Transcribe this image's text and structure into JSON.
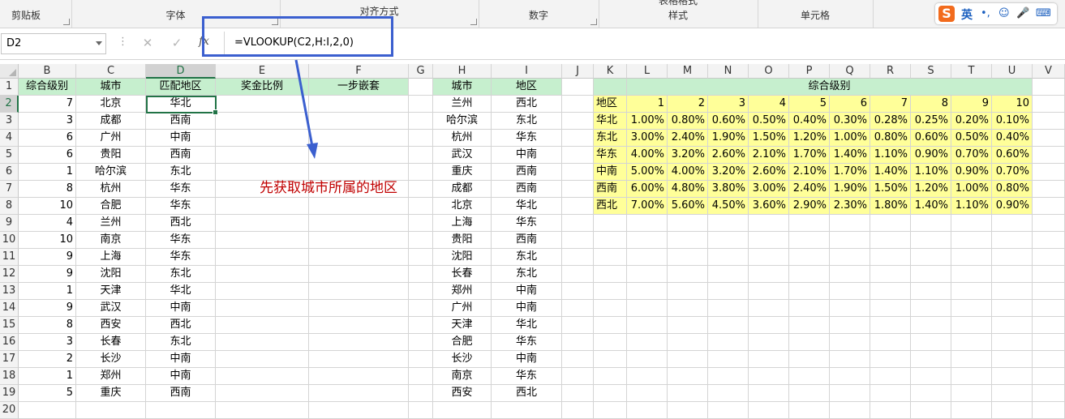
{
  "ribbon": {
    "groups": [
      "剪贴板",
      "字体",
      "对齐方式",
      "数字",
      "样式",
      "单元格"
    ],
    "styles_top": "表格格式",
    "ime": {
      "logo": "S",
      "mode": "英",
      "glyphs": [
        "•,",
        "☺",
        "🎤",
        "⌨"
      ]
    }
  },
  "formula_bar": {
    "name_box": "D2",
    "cancel_icon": "✕",
    "enter_icon": "✓",
    "fx_label": "fx",
    "formula": "=VLOOKUP(C2,H:I,2,0)"
  },
  "columns": [
    "B",
    "C",
    "D",
    "E",
    "F",
    "G",
    "H",
    "I",
    "J",
    "K",
    "L",
    "M",
    "N",
    "O",
    "P",
    "Q",
    "R",
    "S",
    "T",
    "U",
    "V"
  ],
  "rows": [
    "1",
    "2",
    "3",
    "4",
    "5",
    "6",
    "7",
    "8",
    "9",
    "10",
    "11",
    "12",
    "13",
    "14",
    "15",
    "16",
    "17",
    "18",
    "19",
    "20"
  ],
  "left_table": {
    "headers": [
      "综合级别",
      "城市",
      "匹配地区",
      "奖金比例",
      "一步嵌套"
    ],
    "rows": [
      [
        "7",
        "北京",
        "华北"
      ],
      [
        "3",
        "成都",
        "西南"
      ],
      [
        "6",
        "广州",
        "中南"
      ],
      [
        "6",
        "贵阳",
        "西南"
      ],
      [
        "1",
        "哈尔滨",
        "东北"
      ],
      [
        "8",
        "杭州",
        "华东"
      ],
      [
        "10",
        "合肥",
        "华东"
      ],
      [
        "4",
        "兰州",
        "西北"
      ],
      [
        "10",
        "南京",
        "华东"
      ],
      [
        "9",
        "上海",
        "华东"
      ],
      [
        "9",
        "沈阳",
        "东北"
      ],
      [
        "1",
        "天津",
        "华北"
      ],
      [
        "9",
        "武汉",
        "中南"
      ],
      [
        "8",
        "西安",
        "西北"
      ],
      [
        "3",
        "长春",
        "东北"
      ],
      [
        "2",
        "长沙",
        "中南"
      ],
      [
        "1",
        "郑州",
        "中南"
      ],
      [
        "5",
        "重庆",
        "西南"
      ]
    ]
  },
  "lookup_table": {
    "headers": [
      "城市",
      "地区"
    ],
    "rows": [
      [
        "兰州",
        "西北"
      ],
      [
        "哈尔滨",
        "东北"
      ],
      [
        "杭州",
        "华东"
      ],
      [
        "武汉",
        "中南"
      ],
      [
        "重庆",
        "西南"
      ],
      [
        "成都",
        "西南"
      ],
      [
        "北京",
        "华北"
      ],
      [
        "上海",
        "华东"
      ],
      [
        "贵阳",
        "西南"
      ],
      [
        "沈阳",
        "东北"
      ],
      [
        "长春",
        "东北"
      ],
      [
        "郑州",
        "中南"
      ],
      [
        "广州",
        "中南"
      ],
      [
        "天津",
        "华北"
      ],
      [
        "合肥",
        "华东"
      ],
      [
        "长沙",
        "中南"
      ],
      [
        "南京",
        "华东"
      ],
      [
        "西安",
        "西北"
      ]
    ]
  },
  "rate_table": {
    "title": "综合级别",
    "corner": "地区",
    "levels": [
      "1",
      "2",
      "3",
      "4",
      "5",
      "6",
      "7",
      "8",
      "9",
      "10"
    ],
    "rows": [
      {
        "region": "华北",
        "rates": [
          "1.00%",
          "0.80%",
          "0.60%",
          "0.50%",
          "0.40%",
          "0.30%",
          "0.28%",
          "0.25%",
          "0.20%",
          "0.10%"
        ]
      },
      {
        "region": "东北",
        "rates": [
          "3.00%",
          "2.40%",
          "1.90%",
          "1.50%",
          "1.20%",
          "1.00%",
          "0.80%",
          "0.60%",
          "0.50%",
          "0.40%"
        ]
      },
      {
        "region": "华东",
        "rates": [
          "4.00%",
          "3.20%",
          "2.60%",
          "2.10%",
          "1.70%",
          "1.40%",
          "1.10%",
          "0.90%",
          "0.70%",
          "0.60%"
        ]
      },
      {
        "region": "中南",
        "rates": [
          "5.00%",
          "4.00%",
          "3.20%",
          "2.60%",
          "2.10%",
          "1.70%",
          "1.40%",
          "1.10%",
          "0.90%",
          "0.70%"
        ]
      },
      {
        "region": "西南",
        "rates": [
          "6.00%",
          "4.80%",
          "3.80%",
          "3.00%",
          "2.40%",
          "1.90%",
          "1.50%",
          "1.20%",
          "1.00%",
          "0.80%"
        ]
      },
      {
        "region": "西北",
        "rates": [
          "7.00%",
          "5.60%",
          "4.50%",
          "3.60%",
          "2.90%",
          "2.30%",
          "1.80%",
          "1.40%",
          "1.10%",
          "0.90%"
        ]
      }
    ]
  },
  "annotation": "先获取城市所属的地区",
  "colors": {
    "header_green": "#c6efce",
    "highlight_yellow": "#ffff99",
    "selection": "#217346",
    "annotation_box": "#3b5fcf",
    "annotation_text": "#c00000"
  }
}
